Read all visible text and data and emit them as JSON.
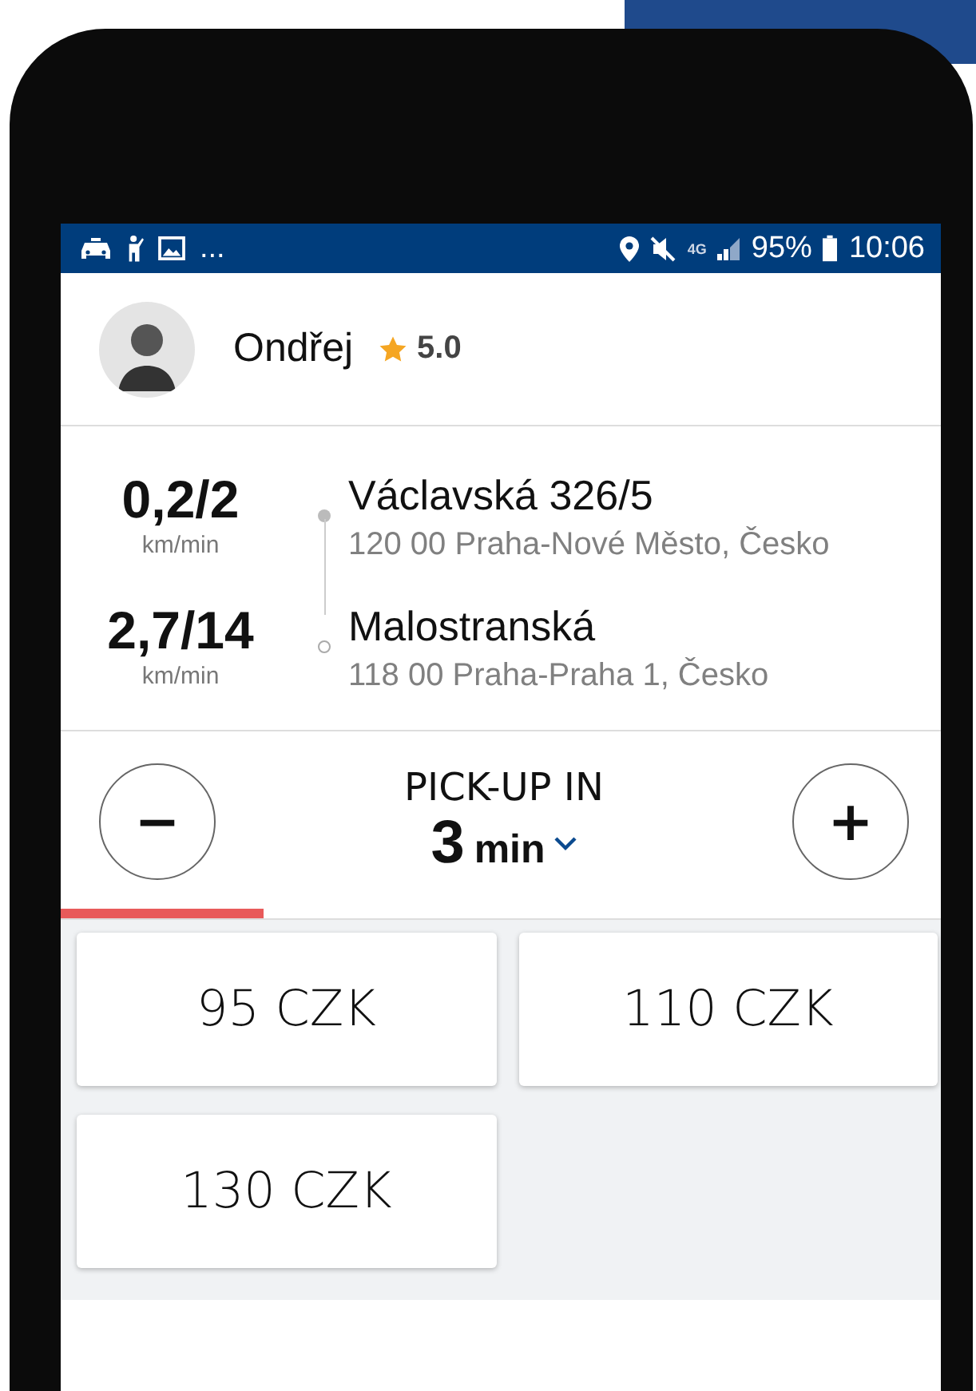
{
  "status_bar": {
    "notification_more": "...",
    "network": "4G",
    "battery": "95%",
    "time": "10:06"
  },
  "driver": {
    "name": "Ondřej",
    "rating": "5.0"
  },
  "route": [
    {
      "kind": "pickup",
      "distance": "0,2/2",
      "unit": "km/min",
      "street": "Václavská 326/5",
      "area": "120 00 Praha-Nové Město, Česko"
    },
    {
      "kind": "destination",
      "distance": "2,7/14",
      "unit": "km/min",
      "street": "Malostranská",
      "area": "118 00 Praha-Praha 1, Česko"
    }
  ],
  "pickup": {
    "label": "PICK-UP IN",
    "value": "3",
    "unit": "min",
    "decrease": "−",
    "increase": "+",
    "level": 0.23
  },
  "offers": [
    {
      "price": "95 CZK"
    },
    {
      "price": "110 CZK"
    },
    {
      "price": "130 CZK"
    }
  ]
}
